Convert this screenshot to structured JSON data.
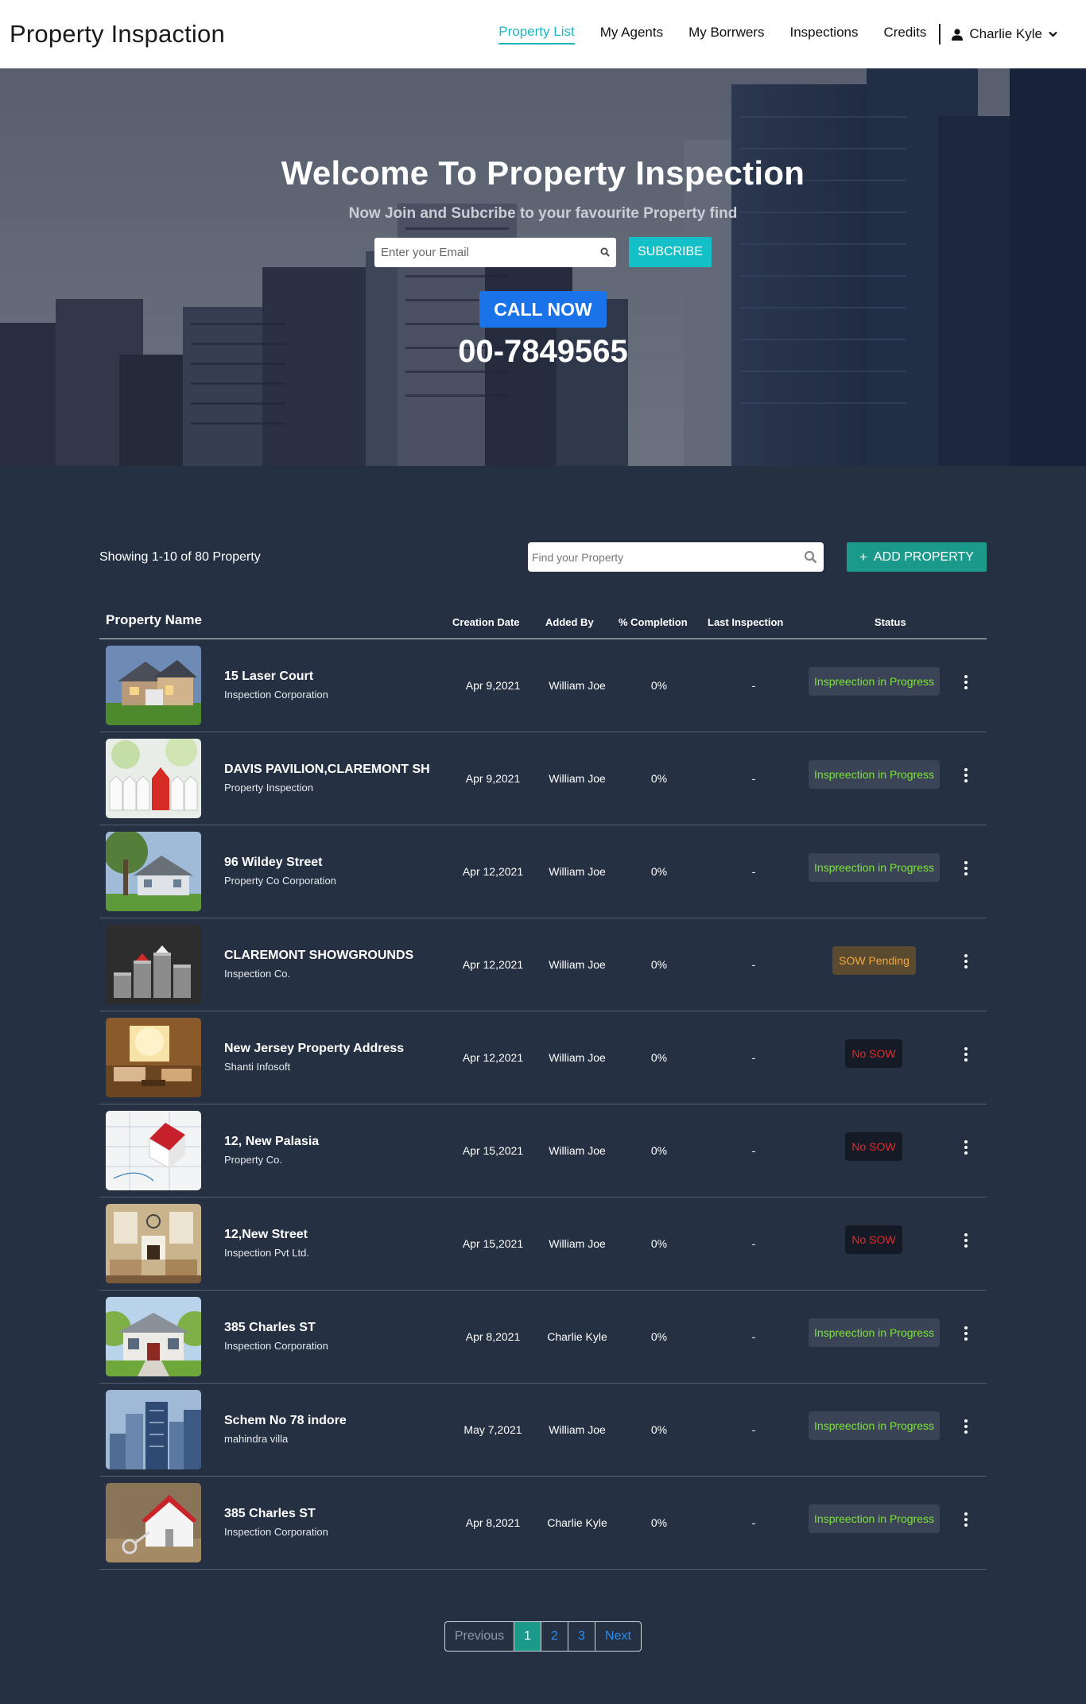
{
  "header": {
    "brand": "Property Inspaction",
    "nav": [
      {
        "label": "Property List",
        "active": true
      },
      {
        "label": "My Agents",
        "active": false
      },
      {
        "label": "My Borrwers",
        "active": false
      },
      {
        "label": "Inspections",
        "active": false
      },
      {
        "label": "Credits",
        "active": false
      }
    ],
    "user_name": "Charlie Kyle"
  },
  "hero": {
    "title": "Welcome To Property Inspection",
    "subtitle": "Now Join and Subcribe to your favourite Property find",
    "email_placeholder": "Enter your Email",
    "subscribe_label": "SUBCRIBE",
    "call_label": "CALL NOW",
    "phone": "00-7849565"
  },
  "toolbar": {
    "showing": "Showing 1-10 of 80 Property",
    "search_placeholder": "Find your Property",
    "add_plus": "+",
    "add_label": "ADD PROPERTY"
  },
  "table": {
    "headers": {
      "name": "Property Name",
      "creation_date": "Creation Date",
      "added_by": "Added By",
      "completion": "% Completion",
      "last_inspection": "Last Inspection",
      "status": "Status"
    },
    "rows": [
      {
        "name": "15 Laser Court",
        "company": "Inspection Corporation",
        "date": "Apr 9,2021",
        "added_by": "William Joe",
        "completion": "0%",
        "last": "-",
        "status": "Inspreection in Progress",
        "status_type": "progress",
        "thumb": "house-suburban"
      },
      {
        "name": "DAVIS PAVILION,CLAREMONT SH",
        "company": "Property Inspection",
        "date": "Apr 9,2021",
        "added_by": "William Joe",
        "completion": "0%",
        "last": "-",
        "status": "Inspreection in Progress",
        "status_type": "progress",
        "thumb": "red-house-fence"
      },
      {
        "name": "96 Wildey Street",
        "company": "Property Co Corporation",
        "date": "Apr 12,2021",
        "added_by": "William Joe",
        "completion": "0%",
        "last": "-",
        "status": "Inspreection in Progress",
        "status_type": "progress",
        "thumb": "house-tree"
      },
      {
        "name": "CLAREMONT SHOWGROUNDS",
        "company": "Inspection Co.",
        "date": "Apr 12,2021",
        "added_by": "William Joe",
        "completion": "0%",
        "last": "-",
        "status": "SOW Pending",
        "status_type": "pending",
        "thumb": "coins-houses"
      },
      {
        "name": "New Jersey Property Address",
        "company": "Shanti Infosoft",
        "date": "Apr 12,2021",
        "added_by": "William Joe",
        "completion": "0%",
        "last": "-",
        "status": "No SOW",
        "status_type": "nosow",
        "thumb": "living-room"
      },
      {
        "name": "12, New Palasia",
        "company": "Property Co.",
        "date": "Apr 15,2021",
        "added_by": "William Joe",
        "completion": "0%",
        "last": "-",
        "status": "No SOW",
        "status_type": "nosow",
        "thumb": "house-blueprint"
      },
      {
        "name": "12,New Street",
        "company": "Inspection Pvt Ltd.",
        "date": "Apr 15,2021",
        "added_by": "William Joe",
        "completion": "0%",
        "last": "-",
        "status": "No SOW",
        "status_type": "nosow",
        "thumb": "interior"
      },
      {
        "name": "385 Charles ST",
        "company": "Inspection Corporation",
        "date": "Apr 8,2021",
        "added_by": "Charlie Kyle",
        "completion": "0%",
        "last": "-",
        "status": "Inspreection in Progress",
        "status_type": "progress",
        "thumb": "porch-house"
      },
      {
        "name": "Schem No 78 indore",
        "company": "mahindra villa",
        "date": "May 7,2021",
        "added_by": "William Joe",
        "completion": "0%",
        "last": "-",
        "status": "Inspreection in Progress",
        "status_type": "progress",
        "thumb": "skyscrapers"
      },
      {
        "name": "385 Charles ST",
        "company": "Inspection Corporation",
        "date": "Apr 8,2021",
        "added_by": "Charlie Kyle",
        "completion": "0%",
        "last": "-",
        "status": "Inspreection in Progress",
        "status_type": "progress",
        "thumb": "house-key"
      }
    ]
  },
  "pagination": {
    "previous": "Previous",
    "pages": [
      "1",
      "2",
      "3"
    ],
    "active": "1",
    "next": "Next"
  },
  "colors": {
    "accent": "#1fb6c4",
    "background": "#253142",
    "primary_button": "#1b9a8c",
    "call_button": "#1a73e8",
    "status_progress": "#7ee23a",
    "status_pending": "#f2a93b",
    "status_nosow": "#e32b2b"
  }
}
